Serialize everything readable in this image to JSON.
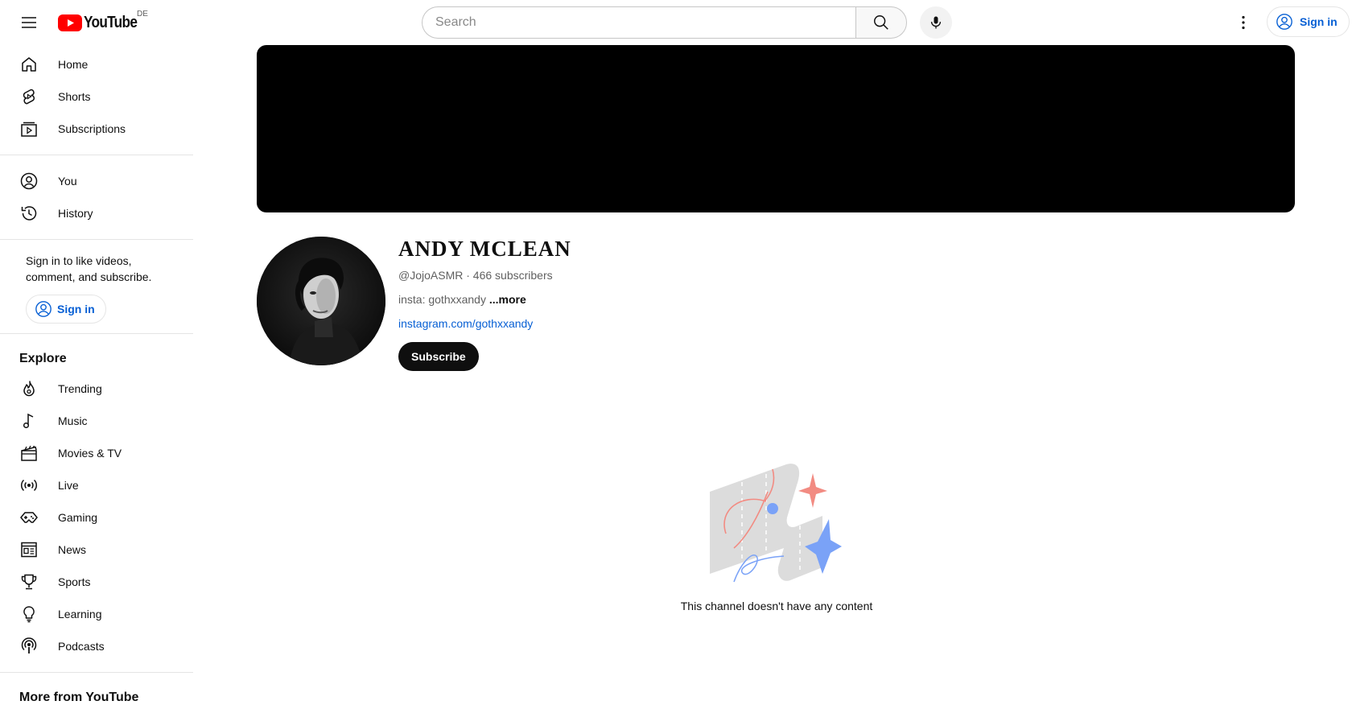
{
  "header": {
    "logo_text": "YouTube",
    "region": "DE",
    "search_placeholder": "Search",
    "sign_in_label": "Sign in"
  },
  "sidebar": {
    "main": [
      {
        "label": "Home",
        "icon": "home-icon"
      },
      {
        "label": "Shorts",
        "icon": "shorts-icon"
      },
      {
        "label": "Subscriptions",
        "icon": "subscriptions-icon"
      }
    ],
    "you": [
      {
        "label": "You",
        "icon": "you-icon"
      },
      {
        "label": "History",
        "icon": "history-icon"
      }
    ],
    "signin_prompt": "Sign in to like videos, comment, and subscribe.",
    "signin_label": "Sign in",
    "explore_title": "Explore",
    "explore": [
      {
        "label": "Trending",
        "icon": "trending-icon"
      },
      {
        "label": "Music",
        "icon": "music-icon"
      },
      {
        "label": "Movies & TV",
        "icon": "movies-icon"
      },
      {
        "label": "Live",
        "icon": "live-icon"
      },
      {
        "label": "Gaming",
        "icon": "gaming-icon"
      },
      {
        "label": "News",
        "icon": "news-icon"
      },
      {
        "label": "Sports",
        "icon": "sports-icon"
      },
      {
        "label": "Learning",
        "icon": "learning-icon"
      },
      {
        "label": "Podcasts",
        "icon": "podcasts-icon"
      }
    ],
    "more_title": "More from YouTube"
  },
  "channel": {
    "name": "ANDY MCLEAN",
    "handle": "@JojoASMR",
    "separator": " · ",
    "subscribers": "466 subscribers",
    "description": "insta: gothxxandy",
    "more_label": "...more",
    "link": "instagram.com/gothxxandy",
    "subscribe_label": "Subscribe"
  },
  "empty_state": {
    "message": "This channel doesn't have any content"
  },
  "colors": {
    "brand_red": "#ff0000",
    "link_blue": "#065fd4",
    "text": "#0f0f0f",
    "secondary_text": "#606060"
  }
}
